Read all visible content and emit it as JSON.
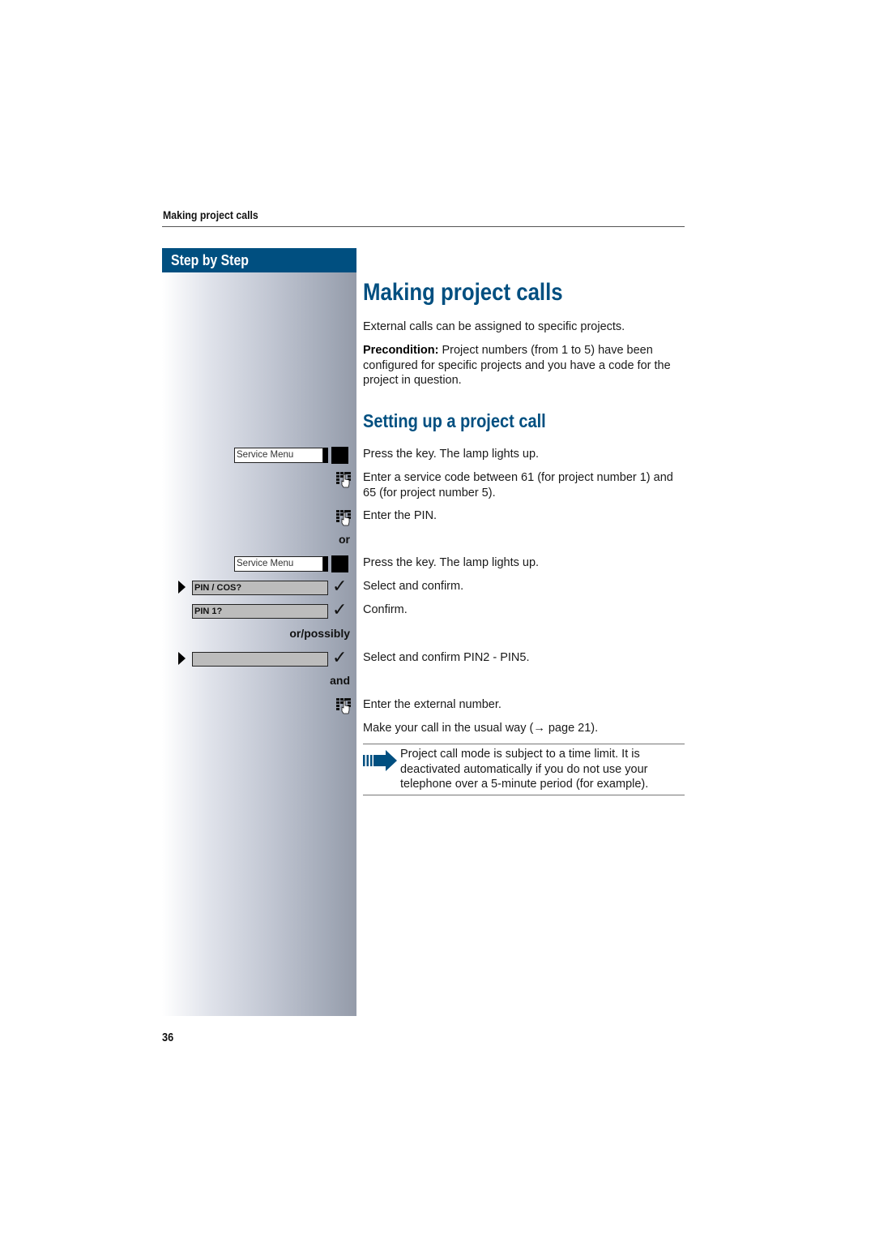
{
  "header": {
    "running_title": "Making project calls"
  },
  "sidebar": {
    "heading": "Step by Step",
    "steps": [
      {
        "type": "key",
        "key_label": "Service Menu"
      },
      {
        "type": "keypad-icon"
      },
      {
        "type": "keypad-icon"
      },
      {
        "type": "connector",
        "label": "or"
      },
      {
        "type": "key",
        "key_label": "Service Menu"
      },
      {
        "type": "menu",
        "label": "PIN / COS?",
        "selected": true
      },
      {
        "type": "menu",
        "label": "PIN 1?",
        "selected": false
      },
      {
        "type": "connector",
        "label": "or/possibly"
      },
      {
        "type": "menu",
        "label": "",
        "selected": true
      },
      {
        "type": "connector",
        "label": "and"
      },
      {
        "type": "keypad-icon"
      }
    ]
  },
  "main": {
    "title": "Making project calls",
    "intro": "External calls can be assigned to specific projects.",
    "precondition_label": "Precondition:",
    "precondition_text": " Project numbers (from 1 to 5) have been configured for specific projects and you have a code for the project in question.",
    "section_title": "Setting up a project call",
    "instructions": [
      "Press the key. The lamp lights up.",
      "Enter a service code between 61 (for project number 1) and 65 (for project number 5).",
      "Enter the PIN.",
      "Press the key. The lamp lights up.",
      "Select and confirm.",
      "Confirm.",
      "Select and confirm PIN2 - PIN5.",
      "Enter the external number.",
      "Make your call in the usual way (→ page 21)."
    ],
    "note": "Project call mode is subject to a time limit. It is deactivated automatically if you do not use your telephone over a 5-minute period (for example)."
  },
  "icons": {
    "key_icon": "function-key-with-lamp-icon",
    "keypad_icon": "keypad-hand-icon",
    "check_icon": "checkmark-icon",
    "select_icon": "triangle-arrow-right-icon",
    "note_icon": "note-arrow-icon",
    "check_glyph": "✓"
  },
  "colors": {
    "brand_blue": "#004f80",
    "menu_gray": "#bcbcbc"
  },
  "footer": {
    "page_number": "36"
  }
}
